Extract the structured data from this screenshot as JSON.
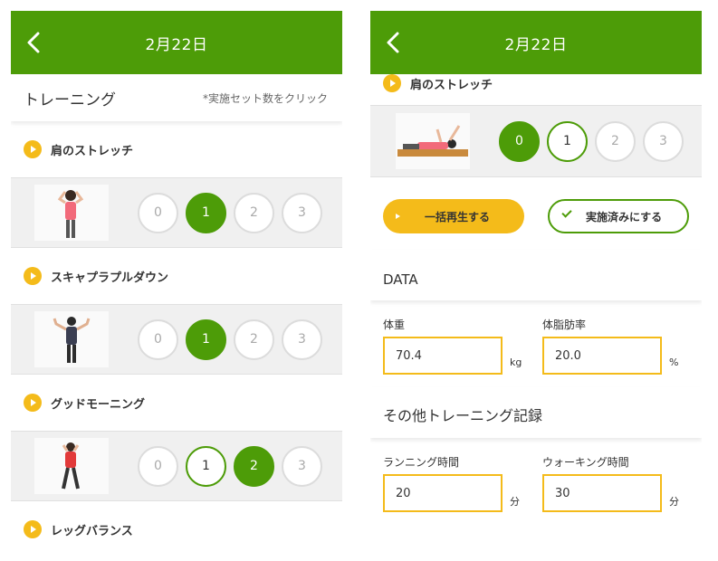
{
  "left": {
    "date": "2月22日",
    "section_title": "トレーニング",
    "section_hint": "*実施セット数をクリック",
    "exercises": [
      {
        "name": "肩のストレッチ",
        "sets": [
          "0",
          "1",
          "2",
          "3"
        ],
        "selected": 1
      },
      {
        "name": "スキャプラプルダウン",
        "sets": [
          "0",
          "1",
          "2",
          "3"
        ],
        "selected": 1
      },
      {
        "name": "グッドモーニング",
        "sets": [
          "0",
          "1",
          "2",
          "3"
        ],
        "selected": 2
      },
      {
        "name": "レッグバランス"
      }
    ]
  },
  "right": {
    "date": "2月22日",
    "exercise_name": "肩のストレッチ",
    "sets": [
      "0",
      "1",
      "2",
      "3"
    ],
    "selected": 0,
    "play_all_label": "一括再生する",
    "mark_done_label": "実施済みにする",
    "data_title": "DATA",
    "weight": {
      "label": "体重",
      "value": "70.4",
      "unit": "kg"
    },
    "body_fat": {
      "label": "体脂肪率",
      "value": "20.0",
      "unit": "%"
    },
    "other_title": "その他トレーニング記録",
    "running": {
      "label": "ランニング時間",
      "value": "20",
      "unit": "分"
    },
    "walking": {
      "label": "ウォーキング時間",
      "value": "30",
      "unit": "分"
    }
  },
  "colors": {
    "brand_green": "#4d9c08",
    "accent_yellow": "#f4bb1a"
  },
  "icons": {
    "back": "chevron-left-icon",
    "play": "play-icon",
    "check": "check-icon"
  }
}
